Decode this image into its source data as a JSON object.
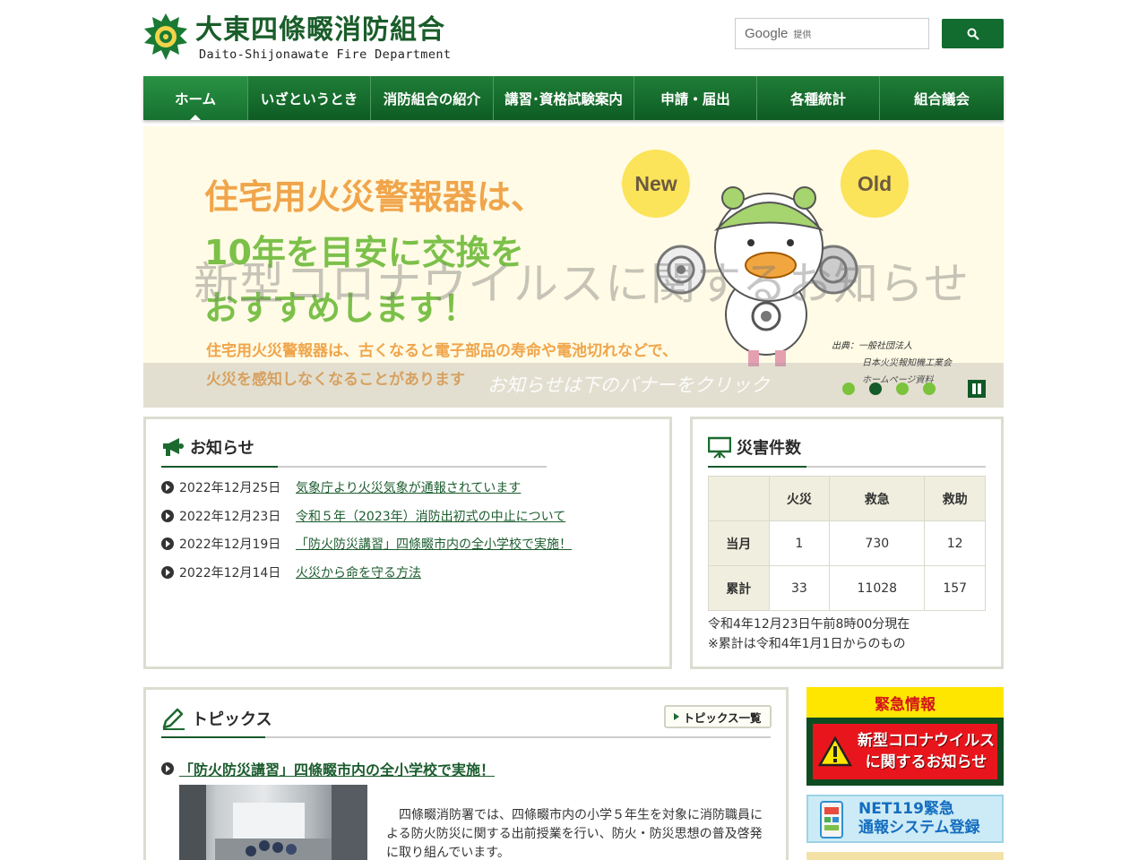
{
  "header": {
    "title": "大東四條畷消防組合",
    "subtitle": "Daito-Shijonawate Fire Department",
    "search": {
      "brand": "Google",
      "provided": "提供"
    }
  },
  "nav": {
    "items": [
      {
        "label": "ホーム",
        "active": true
      },
      {
        "label": "いざというとき"
      },
      {
        "label": "消防組合の紹介"
      },
      {
        "label": "講習･資格試験案内"
      },
      {
        "label": "申請・届出"
      },
      {
        "label": "各種統計"
      },
      {
        "label": "組合議会"
      }
    ]
  },
  "hero": {
    "line1": "住宅用火災警報器は、",
    "line2": "10年を目安に交換を",
    "line3": "おすすめします！",
    "sub1": "住宅用火災警報器は、古くなると電子部品の寿命や電池切れなどで、",
    "sub2": "火災を感知しなくなることがあります",
    "bubble_new": "New",
    "bubble_old": "Old",
    "credit_1": "出典：一般社団法人",
    "credit_2": "日本火災報知機工業会",
    "credit_3": "ホームページ資料",
    "overlay_title": "新型コロナウイルスに関するお知らせ",
    "overlay_caption": "お知らせは下のバナーをクリック",
    "slide_count": 4,
    "active_slide": 2
  },
  "news": {
    "title": "お知らせ",
    "items": [
      {
        "date": "2022年12月25日",
        "text": "気象庁より火災気象が通報されています"
      },
      {
        "date": "2022年12月23日",
        "text": "令和５年（2023年）消防出初式の中止について"
      },
      {
        "date": "2022年12月19日",
        "text": "「防火防災講習」四條畷市内の全小学校で実施！"
      },
      {
        "date": "2022年12月14日",
        "text": "火災から命を守る方法"
      }
    ]
  },
  "disaster": {
    "title": "災害件数",
    "columns": [
      "火災",
      "救急",
      "救助"
    ],
    "rows": [
      {
        "label": "当月",
        "values": [
          "1",
          "730",
          "12"
        ]
      },
      {
        "label": "累計",
        "values": [
          "33",
          "11028",
          "157"
        ]
      }
    ],
    "note1": "令和4年12月23日午前8時00分現在",
    "note2": "※累計は令和4年1月1日からのもの"
  },
  "topics": {
    "title": "トピックス",
    "list_button": "トピックス一覧",
    "item_title": "「防火防災講習」四條畷市内の全小学校で実施！",
    "item_text": "　四條畷消防署では、四條畷市内の小学５年生を対象に消防職員による防火防災に関する出前授業を行い、防火・防災思想の普及啓発に取り組んでいます。"
  },
  "sidebar": {
    "emergency_head": "緊急情報",
    "emergency_line1": "新型コロナウイルス",
    "emergency_line2": "に関するお知らせ",
    "net119_line1": "NET119緊急",
    "net119_line2": "通報システム登録"
  },
  "colors": {
    "brand_green": "#126b2f",
    "nav_green": "#1f7e37",
    "emergency_red": "#e8161c",
    "emergency_yellow": "#ffe600",
    "link_green": "#1c5d2f"
  }
}
